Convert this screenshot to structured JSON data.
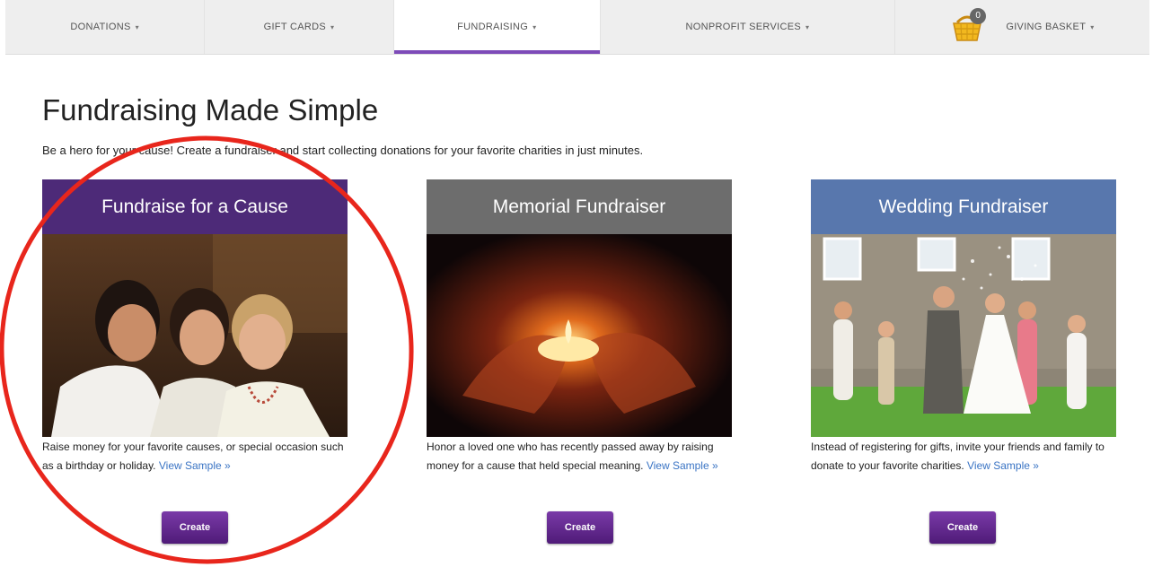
{
  "nav": {
    "donations": "DONATIONS",
    "gift_cards": "GIFT CARDS",
    "fundraising": "FUNDRAISING",
    "nonprofit_services": "NONPROFIT SERVICES",
    "giving_basket": "GIVING BASKET",
    "basket_count": "0",
    "caret": "▾"
  },
  "hero": {
    "title": "Fundraising Made Simple",
    "subtitle": "Be a hero for your cause! Create a fundraiser and start collecting donations for your favorite charities in just minutes."
  },
  "cards": [
    {
      "title": "Fundraise for a Cause",
      "description": "Raise money for your favorite causes, or special occasion such as a birthday or holiday.",
      "link": "View Sample »",
      "button": "Create"
    },
    {
      "title": "Memorial Fundraiser",
      "description": "Honor a loved one who has recently passed away by raising money for a cause that held special meaning.",
      "link": "View Sample »",
      "button": "Create"
    },
    {
      "title": "Wedding Fundraiser",
      "description": "Instead of registering for gifts, invite your friends and family to donate to your favorite charities.",
      "link": "View Sample »",
      "button": "Create"
    }
  ],
  "colors": {
    "accent": "#7d4bb8",
    "card1_header": "#4d2a78",
    "card2_header": "#6d6d6d",
    "card3_header": "#5877ad",
    "link": "#3a74c4",
    "annotation": "#e8261c"
  },
  "icons": {
    "basket": "gift-basket-icon",
    "caret": "caret-down-icon"
  }
}
